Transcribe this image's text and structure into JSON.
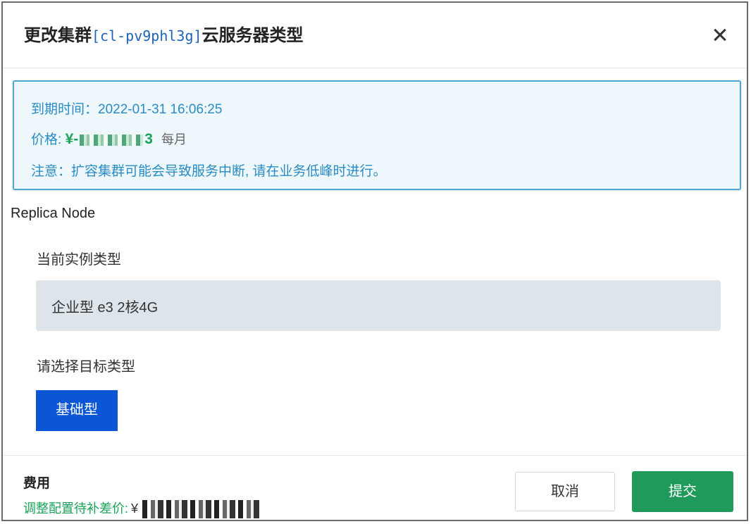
{
  "dialog": {
    "title_prefix": "更改集群",
    "cluster_id": "[cl-pv9phl3g]",
    "title_suffix": "云服务器类型",
    "close_icon": "close-icon"
  },
  "notice": {
    "expire_label": "到期时间：",
    "expire_value": "2022-01-31 16:06:25",
    "price_label": "价格: ",
    "price_start": "¥-",
    "price_end": "3",
    "price_unit": "每月",
    "warning": "注意：扩容集群可能会导致服务中断, 请在业务低峰时进行。",
    "colors": {
      "border": "#49a7d3",
      "text": "#2a8cc5",
      "price": "#1aa45a"
    }
  },
  "section": {
    "title": "Replica Node",
    "current_label": "当前实例类型",
    "current_value": "企业型 e3 2核4G",
    "target_label": "请选择目标类型",
    "target_option": "基础型"
  },
  "footer": {
    "fee_title": "费用",
    "diff_label": "调整配置待补差价:",
    "currency": "¥",
    "cancel_label": "取消",
    "submit_label": "提交",
    "colors": {
      "submit": "#1f9a5a",
      "accent": "#0b56d4"
    }
  }
}
